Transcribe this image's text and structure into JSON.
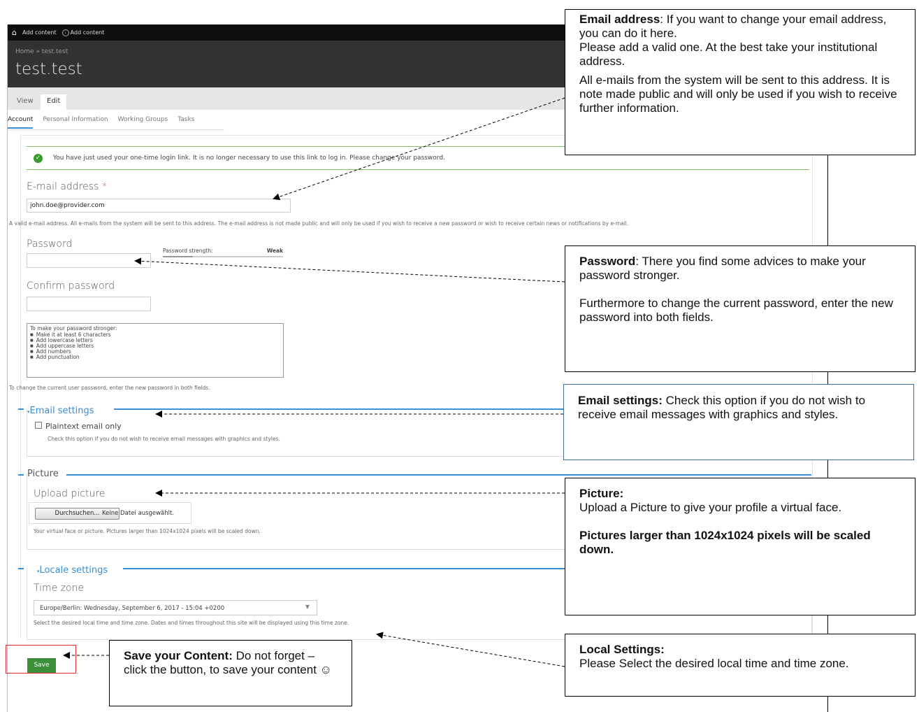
{
  "toolbar": {
    "home_icon": "home-icon",
    "item1": "Add content",
    "item2": "Add content",
    "item2_icon": "arrow-circle-icon"
  },
  "header": {
    "breadcrumb": "Home » test.test",
    "title": "test.test"
  },
  "primary_tabs": [
    {
      "label": "View"
    },
    {
      "label": "Edit"
    }
  ],
  "secondary_tabs": [
    {
      "label": "Account"
    },
    {
      "label": "Personal Information"
    },
    {
      "label": "Working Groups"
    },
    {
      "label": "Tasks"
    }
  ],
  "status_message": "You have just used your one-time login link. It is no longer necessary to use this link to log in. Please change your password.",
  "email": {
    "label": "E-mail address",
    "required_mark": "*",
    "value": "john.doe@provider.com",
    "help": "A valid e-mail address. All e-mails from the system will be sent to this address. The e-mail address is not made public and will only be used if you wish to receive a new password or wish to receive certain news or notifications by e-mail."
  },
  "password": {
    "label": "Password",
    "strength_label": "Password strength:",
    "strength_value": "Weak",
    "strength_fraction": 0.25
  },
  "confirm_password": {
    "label": "Confirm password"
  },
  "password_tips": {
    "heading": "To make your password stronger:",
    "items": [
      "Make it at least 6 characters",
      "Add lowercase letters",
      "Add uppercase letters",
      "Add numbers",
      "Add punctuation"
    ],
    "change_help": "To change the current user password, enter the new password in both fields."
  },
  "email_settings": {
    "legend": "Email settings",
    "collapse_icon": "triangle-down-icon",
    "checkbox_label": "Plaintext email only",
    "checkbox_help": "Check this option if you do not wish to receive email messages with graphics and styles."
  },
  "picture": {
    "legend": "Picture",
    "upload_label": "Upload picture",
    "browse_button": "Durchsuchen...",
    "no_file": "Keine Datei ausgewählt.",
    "help": "Your virtual face or picture. Pictures larger than 1024x1024 pixels will be scaled down."
  },
  "locale": {
    "legend": "Locale settings",
    "timezone_label": "Time zone",
    "timezone_value": "Europe/Berlin: Wednesday, September 6, 2017 - 15:04 +0200",
    "help": "Select the desired local time and time zone. Dates and times throughout this site will be displayed using this time zone."
  },
  "save_button": "Save",
  "annotations": {
    "email": {
      "title": "Email address",
      "line1": ":  If you want to change your email address, you can do it here.",
      "line2": "Please add a valid one. At the best take your institutional address.",
      "line3": "All e-mails from the system will be sent to this address. It is note made public and will only be used if you wish to receive further information."
    },
    "password": {
      "title": "Password",
      "line1": ":  There you find some advices to make your password stronger.",
      "line2": "Furthermore to change the current password, enter the new password into both fields."
    },
    "email_settings": {
      "title": "Email settings:",
      "line1": " Check this option if you do not wish to receive email messages with graphics and styles."
    },
    "picture": {
      "title": "Picture:",
      "line1": "Upload a Picture to give your profile a virtual face.",
      "line2": "Pictures larger than 1024x1024 pixels will be scaled down."
    },
    "locale": {
      "title": "Local Settings:",
      "line1": "Please Select the desired local time and time zone."
    },
    "save": {
      "title": "Save your Content:",
      "line1": " Do not forget  – click the button, to save your content ☺"
    }
  },
  "colors": {
    "accent_blue": "#3a8ed4",
    "save_green": "#3d8f3a",
    "toolbar_black": "#0f0f0f",
    "header_dark": "#323232",
    "highlight_red": "#e03030"
  }
}
